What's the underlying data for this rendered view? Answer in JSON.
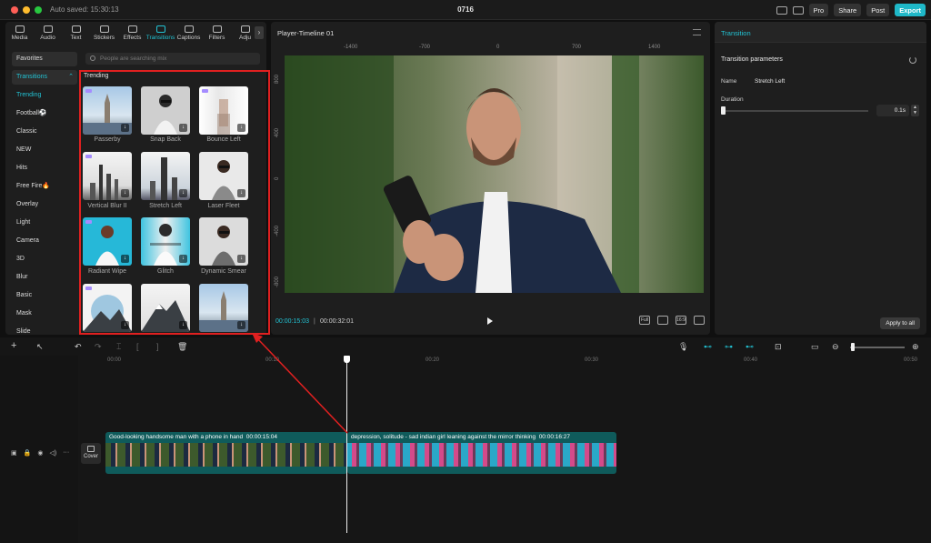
{
  "titlebar": {
    "autosave": "Auto saved: 15:30:13",
    "project": "0716",
    "pro": "Pro",
    "share": "Share",
    "post": "Post",
    "export": "Export"
  },
  "toolbar": {
    "tools": [
      {
        "label": "Media",
        "icon": "media-icon"
      },
      {
        "label": "Audio",
        "icon": "audio-icon"
      },
      {
        "label": "Text",
        "icon": "text-icon"
      },
      {
        "label": "Stickers",
        "icon": "stickers-icon"
      },
      {
        "label": "Effects",
        "icon": "effects-icon"
      },
      {
        "label": "Transitions",
        "icon": "transitions-icon",
        "active": true
      },
      {
        "label": "Captions",
        "icon": "captions-icon"
      },
      {
        "label": "Filters",
        "icon": "filters-icon"
      },
      {
        "label": "Adju",
        "icon": "adjust-icon"
      }
    ],
    "more": "›"
  },
  "categories": [
    "Favorites",
    "Transitions",
    "Trending",
    "Football⚽",
    "Classic",
    "NEW",
    "Hits",
    "Free Fire🔥",
    "Overlay",
    "Light",
    "Camera",
    "3D",
    "Blur",
    "Basic",
    "Mask",
    "Slide"
  ],
  "search": {
    "placeholder": "People are searching mix"
  },
  "section_title": "Trending",
  "transitions": [
    {
      "name": "Passerby"
    },
    {
      "name": "Snap Back"
    },
    {
      "name": "Bounce Left"
    },
    {
      "name": "Vertical Blur II"
    },
    {
      "name": "Stretch Left"
    },
    {
      "name": "Laser Fleet"
    },
    {
      "name": "Radiant Wipe"
    },
    {
      "name": "Glitch"
    },
    {
      "name": "Dynamic Smear"
    },
    {
      "name": ""
    },
    {
      "name": ""
    },
    {
      "name": ""
    }
  ],
  "player": {
    "title": "Player-Timeline 01",
    "ruler_h": [
      "-1400",
      "-700",
      "0",
      "700",
      "1400"
    ],
    "ruler_v": [
      "800",
      "400",
      "0",
      "-400",
      "-800"
    ],
    "current_time": "00:00:15:03",
    "separator": "|",
    "total_time": "00:00:32:01",
    "full_label": "Full",
    "ratio_label": "16:9"
  },
  "right_panel": {
    "title": "Transition",
    "section": "Transition parameters",
    "name_label": "Name",
    "name_value": "Stretch Left",
    "duration_label": "Duration",
    "duration_value": "0.1s",
    "duration_fraction": 0.0,
    "apply_all": "Apply to all"
  },
  "timeline": {
    "ruler": [
      "00:00",
      "00:10",
      "00:20",
      "00:30",
      "00:40",
      "00:50"
    ],
    "cover_label": "Cover",
    "clips": [
      {
        "label": "Good-looking handsome man with a phone in hand",
        "duration": "00:00:15:04"
      },
      {
        "label": "depression, solitude - sad indian girl leaning against the mirror thinking",
        "duration": "00:00:16:27"
      }
    ]
  },
  "colors": {
    "accent": "#22c3d4",
    "highlight": "#e02020",
    "clip": "#0f5b5b"
  }
}
